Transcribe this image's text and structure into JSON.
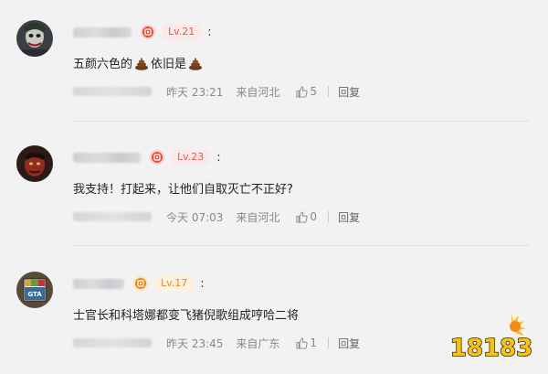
{
  "comments": [
    {
      "level": "Lv.21",
      "level_color": "#e05a5a",
      "colon": ":",
      "text_parts": [
        "五颜六色的",
        "依旧是"
      ],
      "time": "昨天 23:21",
      "location": "来自河北",
      "likes": "5",
      "reply": "回复",
      "avatar": "joker-avatar"
    },
    {
      "level": "Lv.23",
      "level_color": "#e05a5a",
      "colon": ":",
      "text": "我支持！打起来，让他们自取灭亡不正好?",
      "time": "今天 07:03",
      "location": "来自河北",
      "likes": "0",
      "reply": "回复",
      "avatar": "hellboy-avatar"
    },
    {
      "level": "Lv.17",
      "level_color": "#e38a1e",
      "colon": ":",
      "text": "士官长和科塔娜都变飞猪倪歌组成哼哈二将",
      "time": "昨天 23:45",
      "location": "来自广东",
      "likes": "1",
      "reply": "回复",
      "avatar": "gta-avatar"
    }
  ],
  "icons": {
    "emoji": "poop-emoji-icon",
    "badge": "vip-badge-icon",
    "like": "thumbs-up-icon"
  },
  "watermark": {
    "text": "18183"
  }
}
